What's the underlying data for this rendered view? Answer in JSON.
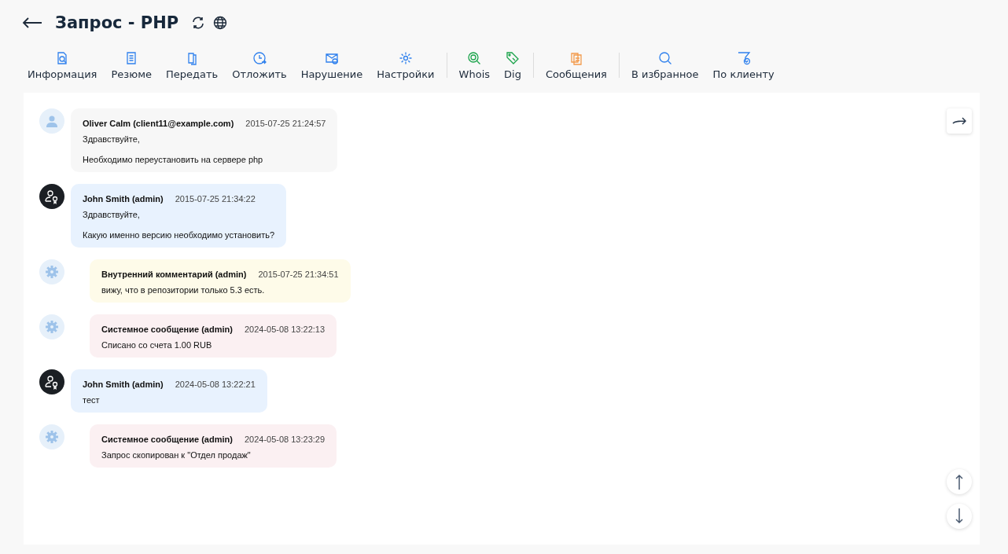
{
  "header": {
    "title": "Запрос - PHP"
  },
  "toolbar": [
    [
      "Информация",
      "Резюме",
      "Передать",
      "Отложить",
      "Нарушение",
      "Настройки"
    ],
    [
      "Whois",
      "Dig"
    ],
    [
      "Сообщения"
    ],
    [
      "В избранное",
      "По клиенту"
    ]
  ],
  "messages": [
    {
      "kind": "client",
      "author": "Oliver Calm (client11@example.com)",
      "time": "2015-07-25 21:24:57",
      "paragraphs": [
        "Здравствуйте,",
        "Необходимо переустановить на сервере php"
      ]
    },
    {
      "kind": "admin",
      "author": "John Smith (admin)",
      "time": "2015-07-25 21:34:22",
      "paragraphs": [
        "Здравствуйте,",
        "Какую именно версию необходимо установить?"
      ]
    },
    {
      "kind": "internal",
      "author": "Внутренний комментарий (admin)",
      "time": "2015-07-25 21:34:51",
      "paragraphs": [
        "вижу, что в репозитории только 5.3 есть."
      ]
    },
    {
      "kind": "system",
      "author": "Системное сообщение (admin)",
      "time": "2024-05-08 13:22:13",
      "paragraphs": [
        "Списано со счета 1.00 RUB"
      ]
    },
    {
      "kind": "admin",
      "author": "John Smith (admin)",
      "time": "2024-05-08 13:22:21",
      "paragraphs": [
        "тест"
      ]
    },
    {
      "kind": "system",
      "author": "Системное сообщение (admin)",
      "time": "2024-05-08 13:23:29",
      "paragraphs": [
        "Запрос скопирован к \"Отдел продаж\""
      ]
    }
  ]
}
